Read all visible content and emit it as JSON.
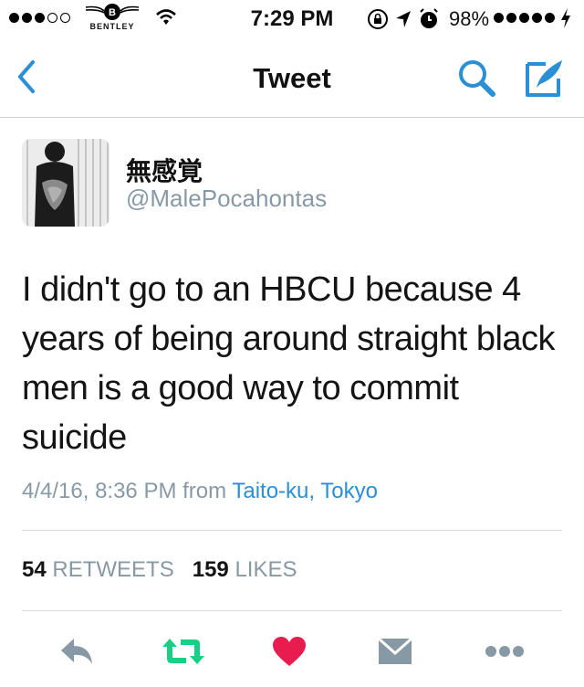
{
  "status_bar": {
    "carrier": "BENTLEY",
    "time": "7:29 PM",
    "battery": "98%"
  },
  "nav": {
    "title": "Tweet",
    "back_icon": "chevron-left-icon",
    "search_icon": "search-icon",
    "compose_icon": "compose-icon"
  },
  "tweet": {
    "display_name": "無感覚",
    "handle": "@MalePocahontas",
    "text": "I didn't go to an HBCU because 4 years of being around straight black men is a good way to commit suicide",
    "timestamp": "4/4/16, 8:36 PM",
    "from_label": "from",
    "location": "Taito-ku, Tokyo",
    "retweet_count": "54",
    "retweet_label": "RETWEETS",
    "like_count": "159",
    "like_label": "LIKES"
  },
  "colors": {
    "accent": "#2b8fd6",
    "retweet": "#19cf86",
    "like": "#e81c4f",
    "muted": "#8899a6"
  }
}
